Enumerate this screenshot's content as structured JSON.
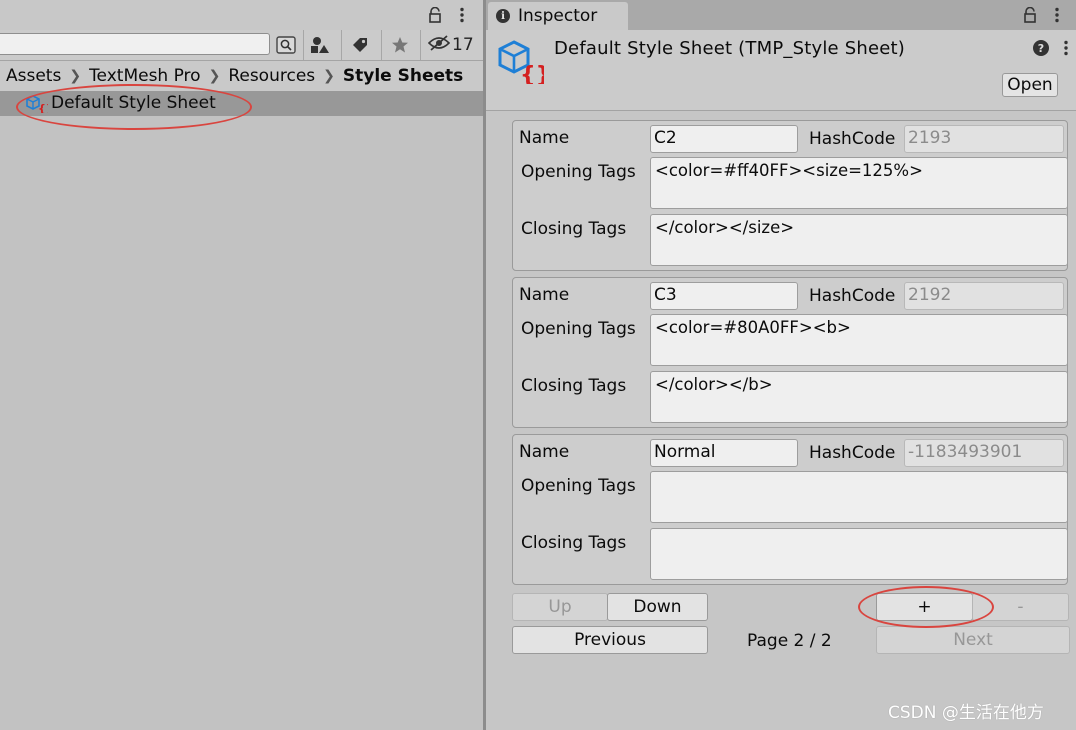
{
  "project": {
    "hidden_count": "17",
    "breadcrumb": [
      "Assets",
      "TextMesh Pro",
      "Resources",
      "Style Sheets"
    ],
    "selected_file": "Default Style Sheet"
  },
  "inspector": {
    "tab_label": "Inspector",
    "asset_title": "Default Style Sheet (TMP_Style Sheet)",
    "open_label": "Open",
    "labels": {
      "name": "Name",
      "hashcode": "HashCode",
      "opening": "Opening Tags",
      "closing": "Closing Tags"
    },
    "styles": [
      {
        "name": "C2",
        "hashcode": "2193",
        "opening": "<color=#ff40FF><size=125%>",
        "closing": "</color></size>"
      },
      {
        "name": "C3",
        "hashcode": "2192",
        "opening": "<color=#80A0FF><b>",
        "closing": "</color></b>"
      },
      {
        "name": "Normal",
        "hashcode": "-1183493901",
        "opening": "",
        "closing": ""
      }
    ],
    "buttons": {
      "up": "Up",
      "down": "Down",
      "add": "+",
      "remove": "-",
      "previous": "Previous",
      "next": "Next"
    },
    "page_label": "Page 2 / 2"
  },
  "watermark": "CSDN @生活在他方",
  "colors": {
    "annotation_ring": "#d9453f",
    "selected_row": "#989898",
    "icon_blue": "#1e7fd6",
    "icon_red": "#d42020"
  }
}
